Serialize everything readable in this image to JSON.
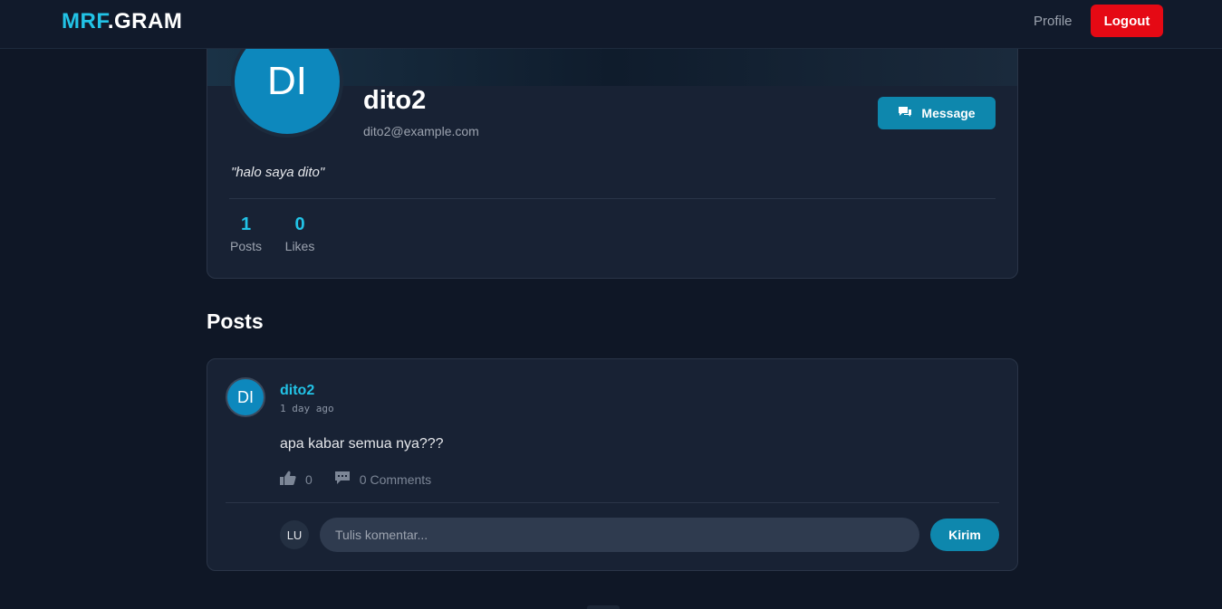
{
  "navbar": {
    "brand_a": "MRF",
    "brand_b": ".GRAM",
    "profile_link": "Profile",
    "logout_label": "Logout"
  },
  "profile": {
    "avatar_initials": "DI",
    "username": "dito2",
    "email": "dito2@example.com",
    "message_label": "Message",
    "message_icon": "message-bubble-icon",
    "bio": "\"halo saya dito\"",
    "stats": [
      {
        "value": "1",
        "label": "Posts"
      },
      {
        "value": "0",
        "label": "Likes"
      }
    ]
  },
  "posts_section": {
    "heading": "Posts"
  },
  "posts": [
    {
      "avatar_initials": "DI",
      "author": "dito2",
      "time": "1 day ago",
      "content": "apa kabar semua nya???",
      "likes": "0",
      "comments_label": "0 Comments",
      "like_icon": "thumbs-up-icon",
      "comment_icon": "comment-icon",
      "comment_box": {
        "user_initials": "LU",
        "placeholder": "Tulis komentar...",
        "value": "",
        "submit_label": "Kirim"
      }
    }
  ],
  "colors": {
    "accent": "#22c3e6",
    "button": "#0e87ad",
    "logout": "#e50914",
    "background": "#0f1726",
    "card": "#182234"
  }
}
